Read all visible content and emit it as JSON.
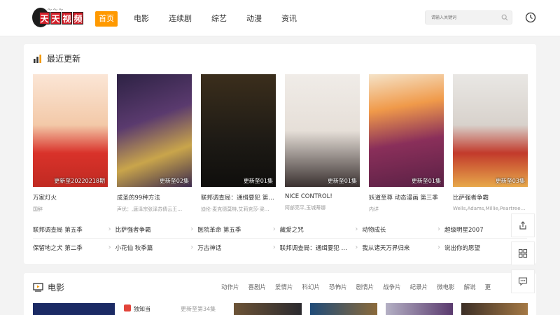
{
  "brand": {
    "logo_chars": [
      "天",
      "天",
      "视",
      "频"
    ]
  },
  "nav": {
    "items": [
      {
        "label": "首页",
        "active": true
      },
      {
        "label": "电影",
        "active": false
      },
      {
        "label": "连续剧",
        "active": false
      },
      {
        "label": "综艺",
        "active": false
      },
      {
        "label": "动漫",
        "active": false
      },
      {
        "label": "资讯",
        "active": false
      }
    ]
  },
  "search": {
    "placeholder": "请输入关键词"
  },
  "recent": {
    "title": "最近更新",
    "cards": [
      {
        "title": "万家灯火",
        "sub": "国醉",
        "episode": "更新至20220218期"
      },
      {
        "title": "成圣的99种方法",
        "sub": "声优：,唐泽宗张泽苏倩云王…",
        "episode": "更新至02集"
      },
      {
        "title": "联邦调查局：通缉要犯 第三季",
        "sub": "迪伦·麦克德莫特,艾莉克莎·梁…",
        "episode": "更新至01集"
      },
      {
        "title": "NICE CONTROL!",
        "sub": "阿部亮平,玉城蒂娜",
        "episode": "更新至01集"
      },
      {
        "title": "妖道至尊 动态漫画 第三季",
        "sub": "内详",
        "episode": "更新至01集"
      },
      {
        "title": "比萨强者争霸",
        "sub": "Wells,Adams,Millie,Peartree…",
        "episode": "更新至03集"
      }
    ],
    "links": [
      [
        "联邦调查局 第五季",
        "比萨强者争霸",
        "医院革命 第五季",
        "藏爱之咒",
        "动物成长",
        "超级明星2007"
      ],
      [
        "保留地之犬 第二季",
        "小花仙 秋季篇",
        "万古神话",
        "联邦调查局：通缉要犯 第三季",
        "我从诸天万界归来",
        "说出你的愿望"
      ]
    ]
  },
  "movie": {
    "title": "电影",
    "tags": [
      "动作片",
      "喜剧片",
      "爱情片",
      "科幻片",
      "恐怖片",
      "剧情片",
      "战争片",
      "纪录片",
      "微电影",
      "解说",
      "更"
    ],
    "first_item": "独知当",
    "first_item_meta": "更新至第34集"
  },
  "colors": {
    "accent": "#ff9900",
    "brand_red": "#d3202a"
  },
  "side_tools": [
    "share-icon",
    "grid-icon",
    "comment-icon"
  ]
}
